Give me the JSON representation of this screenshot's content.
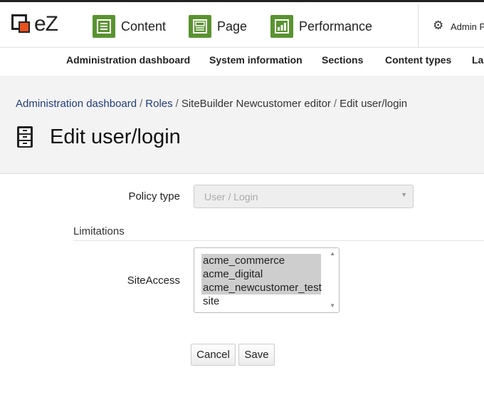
{
  "brand": {
    "logo_text": "eZ",
    "accent_color": "#e8501e",
    "nav_icon_color": "#5a9330"
  },
  "topnav": {
    "tabs": [
      {
        "label": "Content",
        "icon": "content-icon"
      },
      {
        "label": "Page",
        "icon": "page-icon"
      },
      {
        "label": "Performance",
        "icon": "performance-icon"
      }
    ],
    "admin_label": "Admin P",
    "admin_icon": "gear-icon"
  },
  "subnav": {
    "items": [
      "Administration dashboard",
      "System information",
      "Sections",
      "Content types",
      "La"
    ]
  },
  "breadcrumb": {
    "items": [
      "Administration dashboard",
      "Roles",
      "SiteBuilder Newcustomer editor",
      "Edit user/login"
    ],
    "separator": "/"
  },
  "page": {
    "title": "Edit user/login",
    "title_icon": "role-cabinet-icon"
  },
  "form": {
    "policy_type_label": "Policy type",
    "policy_type_value": "User / Login",
    "limitations_label": "Limitations",
    "siteaccess_label": "SiteAccess",
    "siteaccess_options": [
      {
        "label": "acme_commerce",
        "selected": true
      },
      {
        "label": "acme_digital",
        "selected": true
      },
      {
        "label": "acme_newcustomer_test",
        "selected": true
      },
      {
        "label": "site",
        "selected": false
      }
    ],
    "cancel_label": "Cancel",
    "save_label": "Save"
  }
}
